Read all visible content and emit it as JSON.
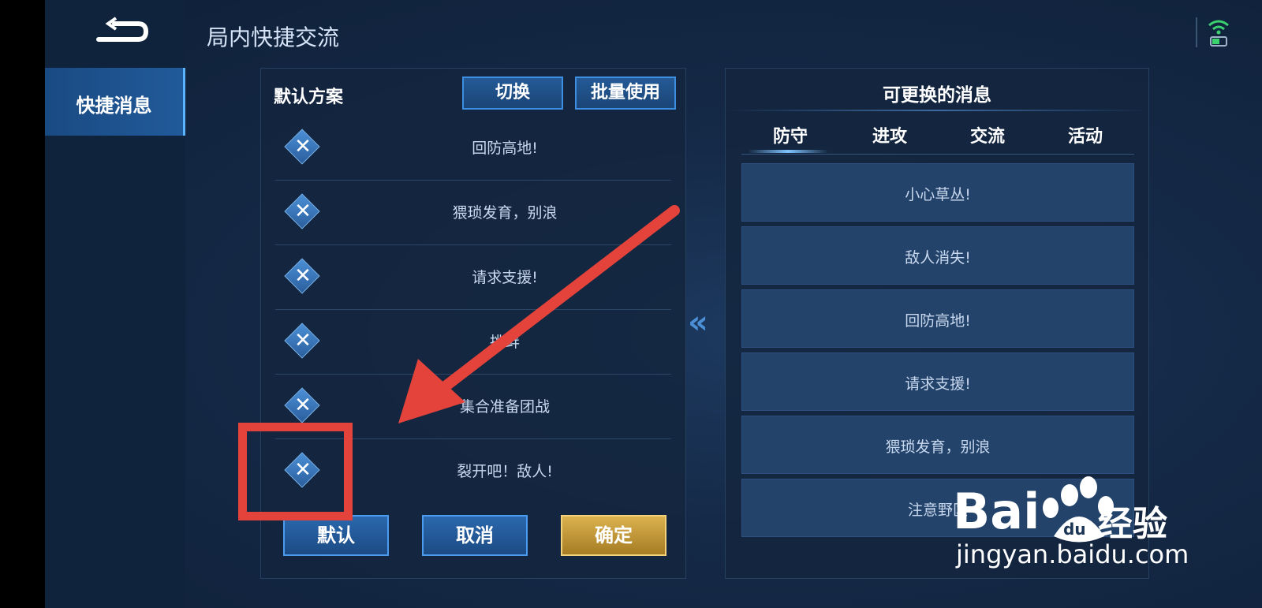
{
  "header": {
    "title": "局内快捷交流"
  },
  "sidebar": {
    "items": [
      {
        "label": "快捷消息"
      }
    ]
  },
  "left_panel": {
    "title": "默认方案",
    "switch_label": "切换",
    "batch_label": "批量使用",
    "messages": [
      "回防高地!",
      "猥琐发育，别浪",
      "请求支援!",
      "挑衅",
      "集合准备团战",
      "裂开吧！敌人!"
    ],
    "footer": {
      "default_label": "默认",
      "cancel_label": "取消",
      "confirm_label": "确定"
    }
  },
  "right_panel": {
    "title": "可更换的消息",
    "tabs": [
      "防守",
      "进攻",
      "交流",
      "活动"
    ],
    "active_tab": "防守",
    "options": [
      "小心草丛!",
      "敌人消失!",
      "回防高地!",
      "请求支援!",
      "猥琐发育，别浪",
      "注意野区"
    ]
  },
  "watermark": {
    "brand": "Bai",
    "brand2": "经验",
    "url": "jingyan.baidu.com"
  },
  "colors": {
    "accent": "#3d8ee0",
    "gold": "#dbb24e",
    "annotation": "#e3433a"
  }
}
